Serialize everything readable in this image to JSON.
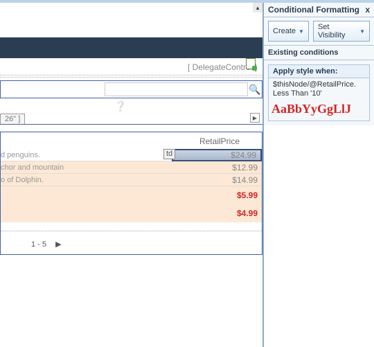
{
  "panel": {
    "title": "Conditional Formatting",
    "close": "x",
    "create": "Create",
    "setvis": "Set Visibility",
    "existing": "Existing conditions",
    "apply": "Apply style when:",
    "expr": "$thisNode/@RetailPrice. Less Than '10'",
    "preview": "AaBbYyGgLlJ"
  },
  "main": {
    "delegate": "[ DelegateControl ]",
    "tablabel": "26\" ]",
    "header": "RetailPrice",
    "tdtag": "td",
    "rows": [
      {
        "desc": "d penguins.",
        "price": "$24.99"
      },
      {
        "desc": "chor and mountain",
        "price": "$12.99"
      },
      {
        "desc": "o of Dolphin.",
        "price": "$14.99"
      },
      {
        "desc": "",
        "price": "$5.99"
      },
      {
        "desc": "",
        "price": "$4.99"
      }
    ],
    "pager": "1 - 5"
  }
}
